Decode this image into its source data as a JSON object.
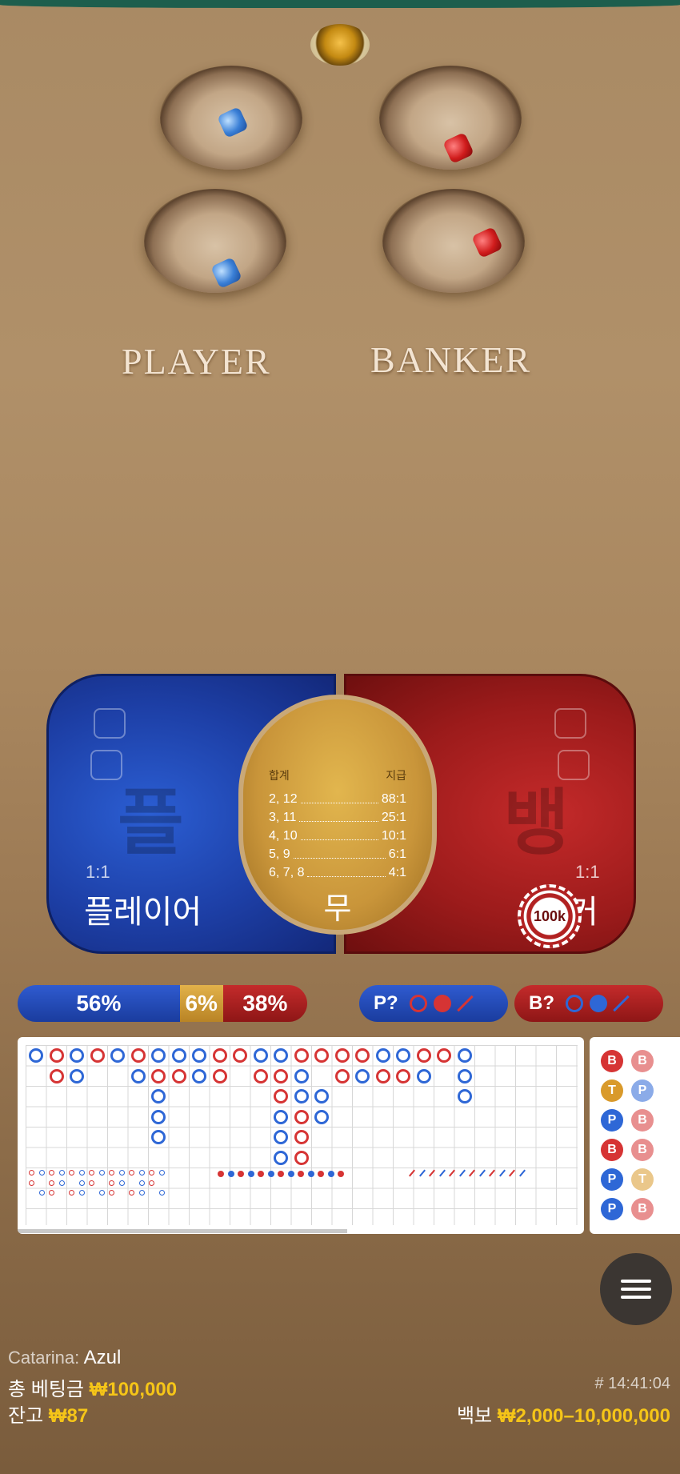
{
  "table": {
    "player_label": "PLAYER",
    "banker_label": "BANKER"
  },
  "bets": {
    "player": {
      "ratio": "1:1",
      "name": "플레이어",
      "ghost": "플"
    },
    "banker": {
      "ratio": "1:1",
      "name": "커",
      "ghost": "뱅"
    },
    "tie": {
      "name": "무",
      "header_left": "합계",
      "header_right": "지급",
      "rows": [
        {
          "sums": "2, 12",
          "payout": "88:1"
        },
        {
          "sums": "3, 11",
          "payout": "25:1"
        },
        {
          "sums": "4, 10",
          "payout": "10:1"
        },
        {
          "sums": "5, 9",
          "payout": "6:1"
        },
        {
          "sums": "6, 7, 8",
          "payout": "4:1"
        }
      ]
    },
    "chip_label": "100k"
  },
  "stats": {
    "player_pct": "56%",
    "tie_pct": "6%",
    "banker_pct": "38%",
    "player_fraction": 0.56,
    "tie_fraction": 0.06,
    "banker_fraction": 0.38
  },
  "predict": {
    "player_label": "P?",
    "banker_label": "B?"
  },
  "bead_road": [
    [
      "B",
      "B"
    ],
    [
      "T",
      "P"
    ],
    [
      "P",
      "B"
    ],
    [
      "B",
      "B"
    ],
    [
      "P",
      "T"
    ],
    [
      "P",
      "B"
    ]
  ],
  "colors": {
    "player": "#2e67d6",
    "banker": "#d63434",
    "tie": "#d99a2b",
    "gold": "#f5c518"
  },
  "info": {
    "user_label": "Catarina:",
    "user_name": "Azul",
    "total_bet_label": "총 베팅금",
    "total_bet_value": "₩100,000",
    "balance_label": "잔고",
    "balance_value": "₩87",
    "round_id": "# 14:41:04",
    "limits_label": "백보",
    "limits_value": "₩2,000–10,000,000"
  },
  "icons": {
    "menu": "hamburger-icon"
  }
}
